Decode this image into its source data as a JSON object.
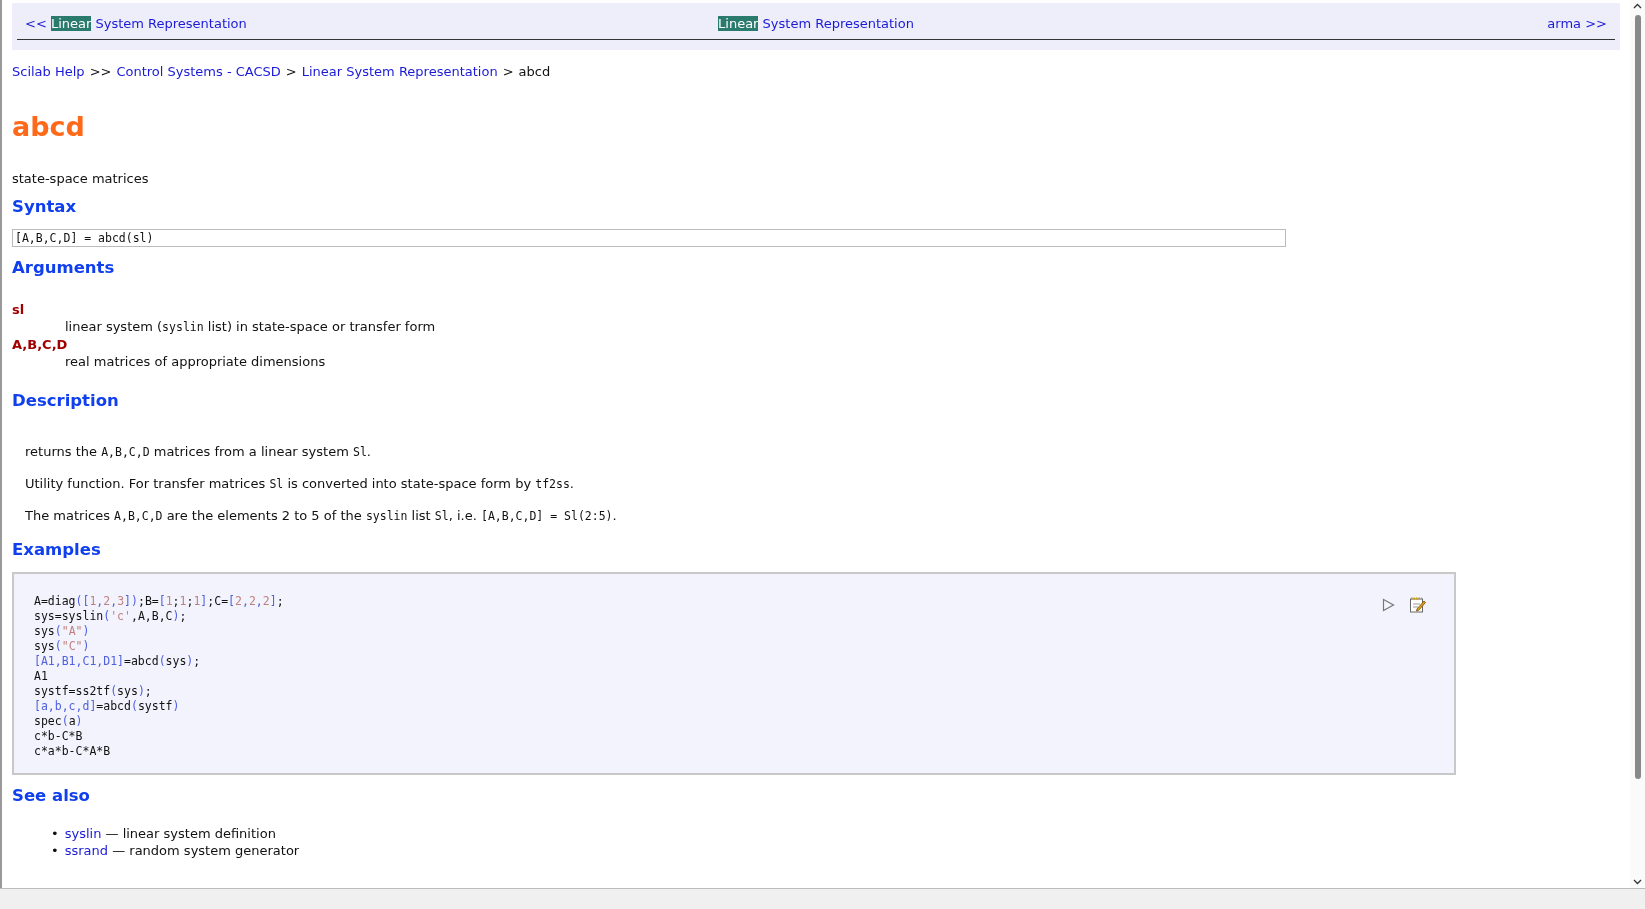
{
  "nav": {
    "previous": [
      {
        "text": "<< ",
        "highlighted": false
      },
      {
        "text": "Linear",
        "highlighted": true
      },
      {
        "text": " System Representation",
        "highlighted": false
      }
    ],
    "current": [
      {
        "text": "Linear",
        "highlighted": true
      },
      {
        "text": " System Representation",
        "highlighted": false
      }
    ],
    "next": [
      {
        "text": "arma >>",
        "highlighted": false
      }
    ]
  },
  "breadcrumb": [
    {
      "text": "Scilab Help",
      "link": true
    },
    {
      "text": ">>",
      "link": false
    },
    {
      "text": "Control Systems - CACSD",
      "link": true
    },
    {
      "text": ">",
      "link": false
    },
    {
      "text": "Linear System Representation",
      "link": true
    },
    {
      "text": ">",
      "link": false
    },
    {
      "text": "abcd",
      "link": false
    }
  ],
  "title": "abcd",
  "summary": "state-space matrices",
  "syntax": {
    "heading": "Syntax",
    "code": "[A,B,C,D] = abcd(sl)"
  },
  "arguments": {
    "heading": "Arguments",
    "items": [
      {
        "term": "sl",
        "description": [
          {
            "text": "linear system (",
            "kind": "text"
          },
          {
            "text": "syslin",
            "kind": "code"
          },
          {
            "text": " list) in state-space or transfer form",
            "kind": "text"
          }
        ]
      },
      {
        "term": "A,B,C,D",
        "description": [
          {
            "text": "real matrices of appropriate dimensions",
            "kind": "text"
          }
        ]
      }
    ]
  },
  "description": {
    "heading": "Description",
    "paragraphs": [
      [
        {
          "text": "returns the ",
          "kind": "text"
        },
        {
          "text": "A,B,C,D",
          "kind": "code"
        },
        {
          "text": " matrices from a linear system ",
          "kind": "text"
        },
        {
          "text": "Sl",
          "kind": "code"
        },
        {
          "text": ".",
          "kind": "text"
        }
      ],
      [
        {
          "text": "Utility function. For transfer matrices ",
          "kind": "text"
        },
        {
          "text": "Sl",
          "kind": "code"
        },
        {
          "text": " is converted into state-space form by ",
          "kind": "text"
        },
        {
          "text": "tf2ss",
          "kind": "code"
        },
        {
          "text": ".",
          "kind": "text"
        }
      ],
      [
        {
          "text": "The matrices ",
          "kind": "text"
        },
        {
          "text": "A,B,C,D",
          "kind": "code"
        },
        {
          "text": " are the elements 2 to 5 of the ",
          "kind": "text"
        },
        {
          "text": "syslin",
          "kind": "code"
        },
        {
          "text": " list ",
          "kind": "text"
        },
        {
          "text": "Sl",
          "kind": "code"
        },
        {
          "text": ", i.e. ",
          "kind": "text"
        },
        {
          "text": "[A,B,C,D] = Sl(2:5)",
          "kind": "code"
        },
        {
          "text": ".",
          "kind": "text"
        }
      ]
    ]
  },
  "examples": {
    "heading": "Examples",
    "lines": [
      [
        {
          "text": "A=diag",
          "kind": "plain"
        },
        {
          "text": "([",
          "kind": "bracket"
        },
        {
          "text": "1",
          "kind": "literal"
        },
        {
          "text": ",",
          "kind": "bracket"
        },
        {
          "text": "2",
          "kind": "literal"
        },
        {
          "text": ",",
          "kind": "bracket"
        },
        {
          "text": "3",
          "kind": "literal"
        },
        {
          "text": "])",
          "kind": "bracket"
        },
        {
          "text": ";B=",
          "kind": "plain"
        },
        {
          "text": "[",
          "kind": "bracket"
        },
        {
          "text": "1",
          "kind": "literal"
        },
        {
          "text": ";",
          "kind": "plain"
        },
        {
          "text": "1",
          "kind": "literal"
        },
        {
          "text": ";",
          "kind": "plain"
        },
        {
          "text": "1",
          "kind": "literal"
        },
        {
          "text": "]",
          "kind": "bracket"
        },
        {
          "text": ";C=",
          "kind": "plain"
        },
        {
          "text": "[",
          "kind": "bracket"
        },
        {
          "text": "2",
          "kind": "literal"
        },
        {
          "text": ",",
          "kind": "bracket"
        },
        {
          "text": "2",
          "kind": "literal"
        },
        {
          "text": ",",
          "kind": "bracket"
        },
        {
          "text": "2",
          "kind": "literal"
        },
        {
          "text": "]",
          "kind": "bracket"
        },
        {
          "text": ";",
          "kind": "plain"
        }
      ],
      [
        {
          "text": "sys=syslin",
          "kind": "plain"
        },
        {
          "text": "(",
          "kind": "bracket"
        },
        {
          "text": "'c'",
          "kind": "literal"
        },
        {
          "text": ",A,B,C",
          "kind": "plain"
        },
        {
          "text": ")",
          "kind": "bracket"
        },
        {
          "text": ";",
          "kind": "plain"
        }
      ],
      [
        {
          "text": "sys",
          "kind": "plain"
        },
        {
          "text": "(",
          "kind": "bracket"
        },
        {
          "text": "\"A\"",
          "kind": "literal"
        },
        {
          "text": ")",
          "kind": "bracket"
        }
      ],
      [
        {
          "text": "sys",
          "kind": "plain"
        },
        {
          "text": "(",
          "kind": "bracket"
        },
        {
          "text": "\"C\"",
          "kind": "literal"
        },
        {
          "text": ")",
          "kind": "bracket"
        }
      ],
      [
        {
          "text": "[A1,B1,C1,D1]",
          "kind": "bracket"
        },
        {
          "text": "=abcd",
          "kind": "plain"
        },
        {
          "text": "(",
          "kind": "bracket"
        },
        {
          "text": "sys",
          "kind": "plain"
        },
        {
          "text": ")",
          "kind": "bracket"
        },
        {
          "text": ";",
          "kind": "plain"
        }
      ],
      [
        {
          "text": "A1",
          "kind": "plain"
        }
      ],
      [
        {
          "text": "systf=ss2tf",
          "kind": "plain"
        },
        {
          "text": "(",
          "kind": "bracket"
        },
        {
          "text": "sys",
          "kind": "plain"
        },
        {
          "text": ")",
          "kind": "bracket"
        },
        {
          "text": ";",
          "kind": "plain"
        }
      ],
      [
        {
          "text": "[a,b,c,d]",
          "kind": "bracket"
        },
        {
          "text": "=abcd",
          "kind": "plain"
        },
        {
          "text": "(",
          "kind": "bracket"
        },
        {
          "text": "systf",
          "kind": "plain"
        },
        {
          "text": ")",
          "kind": "bracket"
        }
      ],
      [
        {
          "text": "spec",
          "kind": "plain"
        },
        {
          "text": "(",
          "kind": "bracket"
        },
        {
          "text": "a",
          "kind": "plain"
        },
        {
          "text": ")",
          "kind": "bracket"
        }
      ],
      [
        {
          "text": "c*b-C*B",
          "kind": "plain"
        }
      ],
      [
        {
          "text": "c*a*b-C*A*B",
          "kind": "plain"
        }
      ]
    ]
  },
  "see_also": {
    "heading": "See also",
    "items": [
      {
        "bullet": "•",
        "link": "syslin",
        "text": "— linear system definition"
      },
      {
        "bullet": "•",
        "link": "ssrand",
        "text": "— random system generator"
      }
    ]
  }
}
